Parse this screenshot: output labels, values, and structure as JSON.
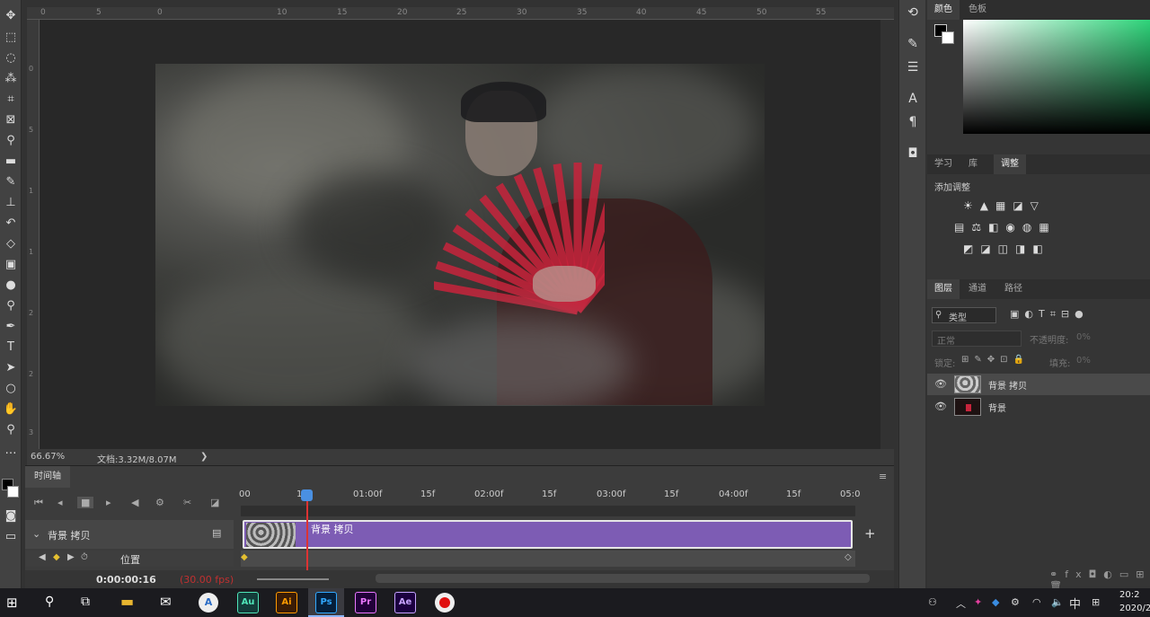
{
  "app": {
    "title": "Adobe Photoshop"
  },
  "ruler_top": [
    "0",
    "5",
    "0",
    "10",
    "15",
    "20",
    "25",
    "30",
    "35",
    "40",
    "45",
    "50",
    "55"
  ],
  "ruler_left": [
    "0",
    "5",
    "1",
    "1",
    "2",
    "2",
    "3"
  ],
  "status": {
    "zoom": "66.67%",
    "doc_info": "文档:3.32M/8.07M",
    "arrow": "❯"
  },
  "timeline": {
    "tab": "时间轴",
    "ruler": [
      "00",
      "10",
      "01:00f",
      "15f",
      "02:00f",
      "15f",
      "03:00f",
      "15f",
      "04:00f",
      "15f",
      "05:0"
    ],
    "layer_name": "背景 拷贝",
    "clip_label": "背景 拷贝",
    "property": "位置",
    "current_time": "0:00:00:16",
    "fps": "(30.00 fps)",
    "add": "+"
  },
  "panels": {
    "color_tabs": [
      "颜色",
      "色板"
    ],
    "adjust_tabs": [
      "学习",
      "库",
      "调整"
    ],
    "adjust_title": "添加调整",
    "adjust_icons_row1": "☀▲▦◪▽",
    "adjust_icons_row2": "▤⚖◧◉◍▦",
    "adjust_icons_row3": "◩◪◫◨◧",
    "layer_tabs": [
      "图层",
      "通道",
      "路径"
    ],
    "filter_label": "类型",
    "blend_mode": "正常",
    "opacity_label": "不透明度:",
    "opacity_value": "0%",
    "lock_label": "锁定:",
    "fill_label": "填充:",
    "fill_value": "0%",
    "layers": [
      {
        "name": "背景 拷贝",
        "selected": true
      },
      {
        "name": "背景",
        "selected": false
      }
    ]
  },
  "taskbar": {
    "apps": [
      "Au",
      "Ai",
      "Ps",
      "Pr",
      "Ae"
    ],
    "ime": "中",
    "clock_time": "20:2",
    "clock_date": "2020/2"
  },
  "colors": {
    "clip": "#7d5cb4",
    "playhead": "#d33333",
    "fan": "#c8243c"
  }
}
